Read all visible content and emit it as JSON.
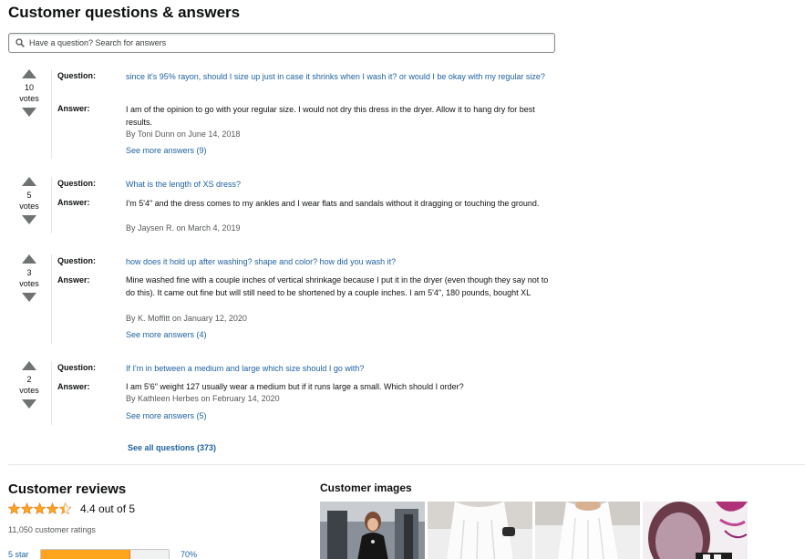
{
  "qa": {
    "title": "Customer questions & answers",
    "search_placeholder": "Have a question? Search for answers",
    "question_label": "Question:",
    "answer_label": "Answer:",
    "votes_label": "votes",
    "items": [
      {
        "votes": "10",
        "question": "since it's 95% rayon, should I size up just in case it shrinks when I wash it? or would I be okay with my regular size?",
        "answer": "I am of the opinion to go with your regular size. I would not dry this dress in the dryer. Allow it to hang dry for best results.",
        "byline": "By Toni Dunn on June 14, 2018",
        "more": "See more answers (9)"
      },
      {
        "votes": "5",
        "question": "What is the length of XS dress?",
        "answer": "I'm 5'4\" and the dress comes to my ankles and I wear flats and sandals without it dragging or touching the ground.",
        "byline": "By Jaysen R. on March 4, 2019",
        "more": ""
      },
      {
        "votes": "3",
        "question": "how does it hold up after washing? shape and color? how did you wash it?",
        "answer": "Mine washed fine with a couple inches of vertical shrinkage because I put it in the dryer (even though they say not to do this). It came out fine but will still need to be shortened by a couple inches. I am 5'4\", 180 pounds, bought XL",
        "byline": "By K. Moffitt on January 12, 2020",
        "more": "See more answers (4)"
      },
      {
        "votes": "2",
        "question": "If I'm in between a medium and large which size should I go with?",
        "answer": "I am 5'6\" weight 127 usually wear a medium but if it runs large a small. Which should I order?",
        "byline": "By Kathleen Herbes on February 14, 2020",
        "more": "See more answers (5)"
      }
    ],
    "see_all": "See all questions (373)"
  },
  "reviews": {
    "title": "Customer reviews",
    "rating_text": "4.4 out of 5",
    "rating_value": 4.4,
    "ratings_count": "11,050 customer ratings",
    "breakdown": [
      {
        "label": "5 star",
        "percent_text": "70%",
        "percent": 70
      }
    ]
  },
  "images": {
    "title": "Customer images"
  },
  "colors": {
    "link": "#2162a1",
    "star": "#ffa41c",
    "text": "#0f1111",
    "muted": "#565959"
  }
}
